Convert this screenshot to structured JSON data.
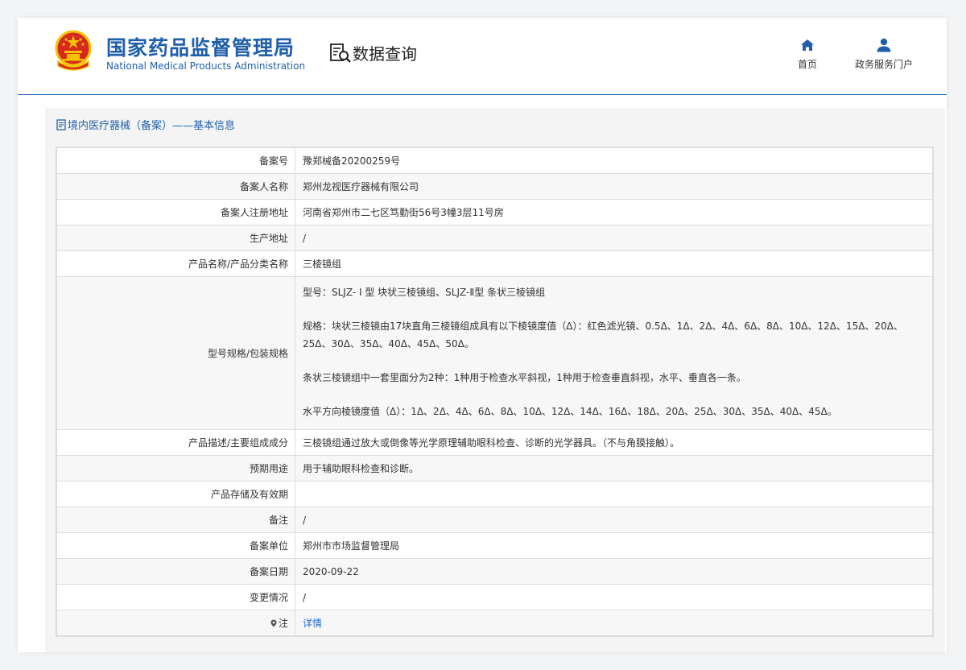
{
  "header": {
    "brand_cn": "国家药品监督管理局",
    "brand_en": "National Medical Products Administration",
    "query_title": "数据查询",
    "nav": [
      {
        "label": "首页",
        "icon": "home-icon"
      },
      {
        "label": "政务服务门户",
        "icon": "user-icon"
      }
    ]
  },
  "panel": {
    "title": "境内医疗器械（备案）——基本信息"
  },
  "rows": [
    {
      "key": "备案号",
      "value": "豫郑械备20200259号"
    },
    {
      "key": "备案人名称",
      "value": "郑州龙视医疗器械有限公司"
    },
    {
      "key": "备案人注册地址",
      "value": "河南省郑州市二七区笃勤街56号3幢3层11号房"
    },
    {
      "key": "生产地址",
      "value": "/"
    },
    {
      "key": "产品名称/产品分类名称",
      "value": "三棱镜组"
    },
    {
      "key": "型号规格/包装规格",
      "paragraphs": [
        "型号：SLJZ- Ⅰ 型 块状三棱镜组、SLJZ-Ⅱ型 条状三棱镜组",
        "规格：块状三棱镜由17块直角三棱镜组成具有以下棱镜度值（Δ）：红色滤光镜、0.5Δ、1Δ、2Δ、4Δ、6Δ、8Δ、10Δ、12Δ、15Δ、20Δ、25Δ、30Δ、35Δ、40Δ、45Δ、50Δ。",
        "条状三棱镜组中一套里面分为2种：1种用于检查水平斜视，1种用于检查垂直斜视，水平、垂直各一条。",
        "水平方向棱镜度值（Δ）：1Δ、2Δ、4Δ、6Δ、8Δ、10Δ、12Δ、14Δ、16Δ、18Δ、20Δ、25Δ、30Δ、35Δ、40Δ、45Δ。"
      ]
    },
    {
      "key": "产品描述/主要组成成分",
      "value": "三棱镜组通过放大或倒像等光学原理辅助眼科检查、诊断的光学器具。（不与角膜接触）。"
    },
    {
      "key": "预期用途",
      "value": "用于辅助眼科检查和诊断。"
    },
    {
      "key": "产品存储及有效期",
      "value": ""
    },
    {
      "key": "备注",
      "value": "/"
    },
    {
      "key": "备案单位",
      "value": "郑州市市场监督管理局"
    },
    {
      "key": "备案日期",
      "value": "2020-09-22"
    },
    {
      "key": "变更情况",
      "value": "/"
    },
    {
      "key": "注",
      "value": "详情",
      "key_icon": "location-pin-icon"
    }
  ],
  "colors": {
    "brand_blue": "#1f5faa",
    "link_blue": "#1f6fd0",
    "emblem_red": "#d52b1e",
    "emblem_gold": "#f5c400"
  }
}
